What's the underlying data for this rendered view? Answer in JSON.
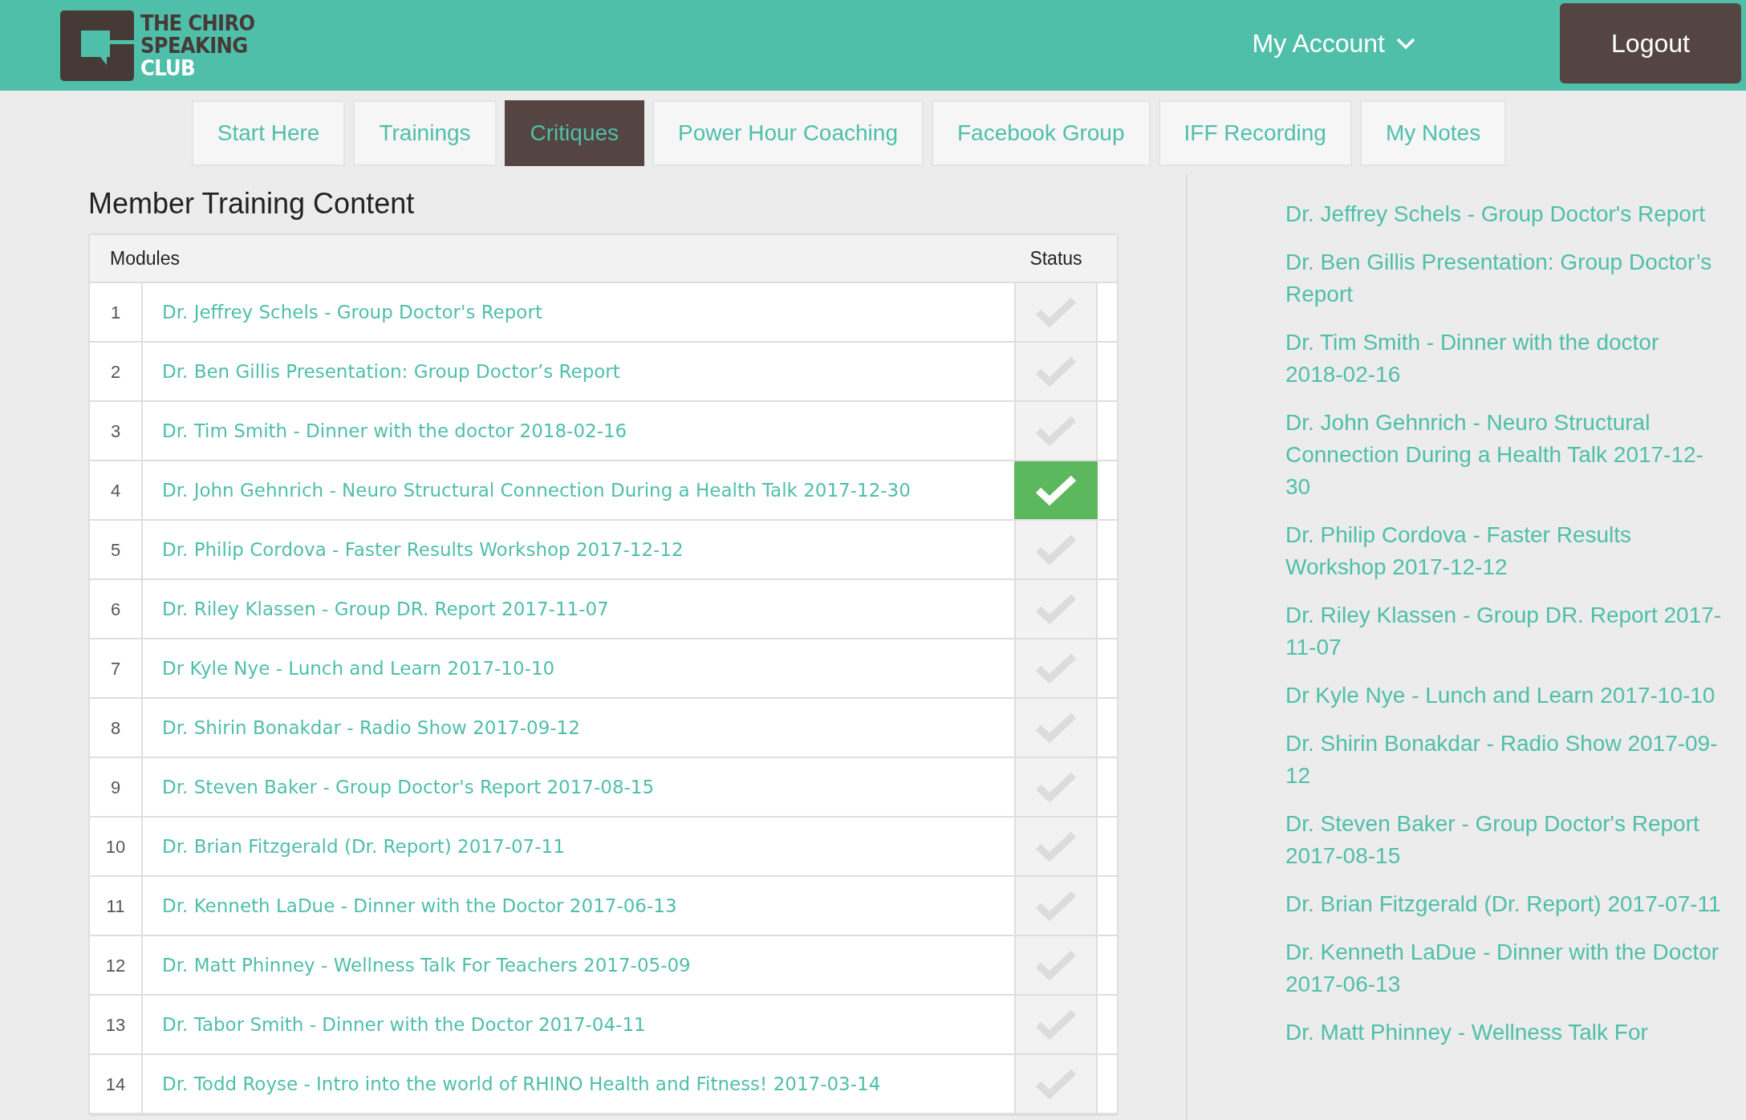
{
  "header": {
    "logo": {
      "line_1": "THE CHIRO",
      "line_2": "SPEAKING",
      "line_3": "CLUB"
    },
    "account_menu": "My Account",
    "logout": "Logout"
  },
  "tabs": [
    {
      "label": "Start Here",
      "selected": false
    },
    {
      "label": "Trainings",
      "selected": false
    },
    {
      "label": "Critiques",
      "selected": true
    },
    {
      "label": "Power Hour Coaching",
      "selected": false
    },
    {
      "label": "Facebook Group",
      "selected": false
    },
    {
      "label": "IFF Recording",
      "selected": false
    },
    {
      "label": "My Notes",
      "selected": false
    }
  ],
  "content": {
    "title": "Member Training Content",
    "table": {
      "columns": [
        "Modules",
        "Status"
      ],
      "rows": [
        {
          "number": "1",
          "title": "Dr. Jeffrey Schels - Group Doctor's Report",
          "completed": false
        },
        {
          "number": "2",
          "title": "Dr. Ben Gillis Presentation: Group Doctor’s Report",
          "completed": false
        },
        {
          "number": "3",
          "title": "Dr. Tim Smith - Dinner with the doctor 2018-02-16",
          "completed": false
        },
        {
          "number": "4",
          "title": "Dr. John Gehnrich - Neuro Structural Connection During a Health Talk 2017-12-30",
          "completed": true
        },
        {
          "number": "5",
          "title": "Dr. Philip Cordova - Faster Results Workshop 2017-12-12",
          "completed": false
        },
        {
          "number": "6",
          "title": "Dr. Riley Klassen - Group DR. Report 2017-11-07",
          "completed": false
        },
        {
          "number": "7",
          "title": "Dr Kyle Nye - Lunch and Learn 2017-10-10",
          "completed": false
        },
        {
          "number": "8",
          "title": "Dr. Shirin Bonakdar - Radio Show 2017-09-12",
          "completed": false
        },
        {
          "number": "9",
          "title": "Dr. Steven Baker - Group Doctor's Report 2017-08-15",
          "completed": false
        },
        {
          "number": "10",
          "title": "Dr. Brian Fitzgerald (Dr. Report) 2017-07-11",
          "completed": false
        },
        {
          "number": "11",
          "title": "Dr. Kenneth LaDue - Dinner with the Doctor 2017-06-13",
          "completed": false
        },
        {
          "number": "12",
          "title": "Dr. Matt Phinney - Wellness Talk For Teachers 2017-05-09",
          "completed": false
        },
        {
          "number": "13",
          "title": "Dr. Tabor Smith - Dinner with the Doctor 2017-04-11",
          "completed": false
        },
        {
          "number": "14",
          "title": "Dr. Todd Royse - Intro into the world of RHINO Health and Fitness! 2017-03-14",
          "completed": false
        }
      ]
    }
  },
  "sidebar": {
    "items": [
      "Dr. Jeffrey Schels - Group Doctor's Report",
      "Dr. Ben Gillis Presentation: Group Doctor’s Report",
      "Dr. Tim Smith - Dinner with the doctor 2018-02-16",
      "Dr. John Gehnrich - Neuro Structural Connection During a Health Talk 2017-12-30",
      "Dr. Philip Cordova - Faster Results Workshop 2017-12-12",
      "Dr. Riley Klassen - Group DR. Report 2017-11-07",
      "Dr Kyle Nye - Lunch and Learn 2017-10-10",
      "Dr. Shirin Bonakdar - Radio Show 2017-09-12",
      "Dr. Steven Baker - Group Doctor's Report 2017-08-15",
      "Dr. Brian Fitzgerald (Dr. Report) 2017-07-11",
      "Dr. Kenneth LaDue - Dinner with the Doctor 2017-06-13",
      "Dr. Matt Phinney - Wellness Talk For"
    ]
  }
}
